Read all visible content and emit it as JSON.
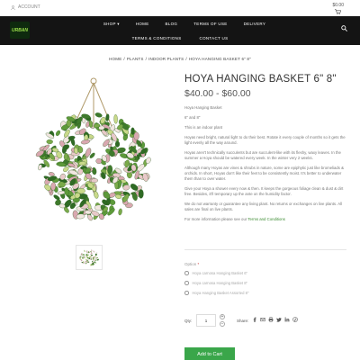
{
  "topbar": {
    "account": "ACCOUNT",
    "cart_total": "$0.00"
  },
  "logo": {
    "text": "URBAN"
  },
  "nav": {
    "row1": [
      "SHOP",
      "HOME",
      "BLOG",
      "TERMS OF USE",
      "DELIVERY"
    ],
    "row2": [
      "TERMS & CONDITIONS",
      "CONTACT US"
    ]
  },
  "breadcrumb": [
    "HOME",
    "PLANTS",
    "INDOOR PLANTS",
    "HOYA HANGING BASKET 6\" 8\""
  ],
  "product": {
    "title": "HOYA HANGING BASKET 6\" 8\"",
    "price": "$40.00 - $60.00",
    "description": [
      "Hoya Hanging Basket",
      "6\" and 8\"",
      "This is an indoor plant",
      "Hoyas need bright, natural light to do their best. Rotate it every couple of months so it gets the light evenly all the way around.",
      "Hoyas aren't technically succulents but are succulent-like with its fleshy, waxy leaves. In the summer a Hoya should be watered every week. In the winter very 2 weeks.",
      "Although many Hoyas are vines & shrubs in nature, some are epiphytic just like bromeliads & orchids. In short, Hoyas don't like their feet to be consistently moist. It's better to underwater them than to over water.",
      "Give your Hoya a shower every now & then. It keeps the gorgeous foliage clean & dust & dirt free. Besides, it'll temporary up the ante on the humidity factor.",
      "We do not warranty or guarantee any living plant. No returns or exchanges on live plants. All sales are final on live plants."
    ],
    "more_info_prefix": "For more information please see our ",
    "more_info_link": "Terms and Conditions"
  },
  "options": {
    "label": "Option",
    "required_mark": "*",
    "items": [
      "Hoya carnosa Hanging Basket 6\"",
      "Hoya carnosa Hanging Basket 8\"",
      "Hoya Hanging Basket Assorted 8\""
    ]
  },
  "purchase": {
    "qty_label": "Qty:",
    "qty_value": "1",
    "share_label": "Share:",
    "add_to_cart": "Add to Cart"
  }
}
